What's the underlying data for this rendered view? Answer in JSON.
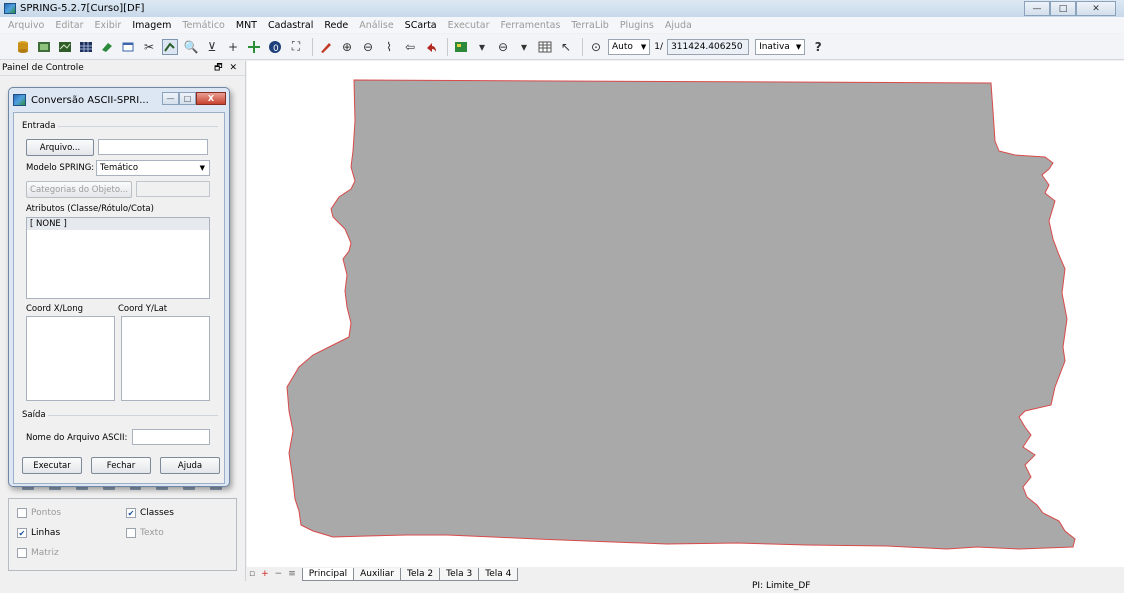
{
  "window": {
    "title": "SPRING-5.2.7[Curso][DF]",
    "controls": {
      "minimize": "—",
      "maximize": "□",
      "close": "✕"
    }
  },
  "menu": [
    {
      "label": "Arquivo",
      "enabled": false
    },
    {
      "label": "Editar",
      "enabled": false
    },
    {
      "label": "Exibir",
      "enabled": false
    },
    {
      "label": "Imagem",
      "enabled": true
    },
    {
      "label": "Temático",
      "enabled": false
    },
    {
      "label": "MNT",
      "enabled": true
    },
    {
      "label": "Cadastral",
      "enabled": true
    },
    {
      "label": "Rede",
      "enabled": true
    },
    {
      "label": "Análise",
      "enabled": false
    },
    {
      "label": "SCarta",
      "enabled": true
    },
    {
      "label": "Executar",
      "enabled": false
    },
    {
      "label": "Ferramentas",
      "enabled": false
    },
    {
      "label": "TerraLib",
      "enabled": false
    },
    {
      "label": "Plugins",
      "enabled": false
    },
    {
      "label": "Ajuda",
      "enabled": false
    }
  ],
  "toolbar": {
    "zoom_mode": "Auto",
    "scale_prefix": "1/",
    "scale_value": "311424.406250",
    "layer_state": "Inativa"
  },
  "control_panel": {
    "title": "Painel de Controle",
    "options": {
      "pontos": "Pontos",
      "classes": "Classes",
      "linhas": "Linhas",
      "texto": "Texto",
      "matriz": "Matriz"
    }
  },
  "dialog": {
    "title": "Conversão ASCII-SPRI...",
    "entrada_label": "Entrada",
    "arquivo_button": "Arquivo...",
    "modelo_label": "Modelo SPRING:",
    "modelo_value": "Temático",
    "categorias_button": "Categorias do Objeto...",
    "atributos_label": "Atributos (Classe/Rótulo/Cota)",
    "atributos_items": [
      "[ NONE ]"
    ],
    "coord_x_label": "Coord X/Long",
    "coord_y_label": "Coord Y/Lat",
    "saida_label": "Saída",
    "nome_arquivo_label": "Nome do Arquivo ASCII:",
    "executar_button": "Executar",
    "fechar_button": "Fechar",
    "ajuda_button": "Ajuda"
  },
  "tabs": {
    "items": [
      "Principal",
      "Auxiliar",
      "Tela 2",
      "Tela 3",
      "Tela 4"
    ],
    "active": "Principal"
  },
  "status": {
    "text": "PI: Limite_DF"
  },
  "colors": {
    "map_fill": "#a9a9a9",
    "map_outline": "#d94a4a"
  }
}
